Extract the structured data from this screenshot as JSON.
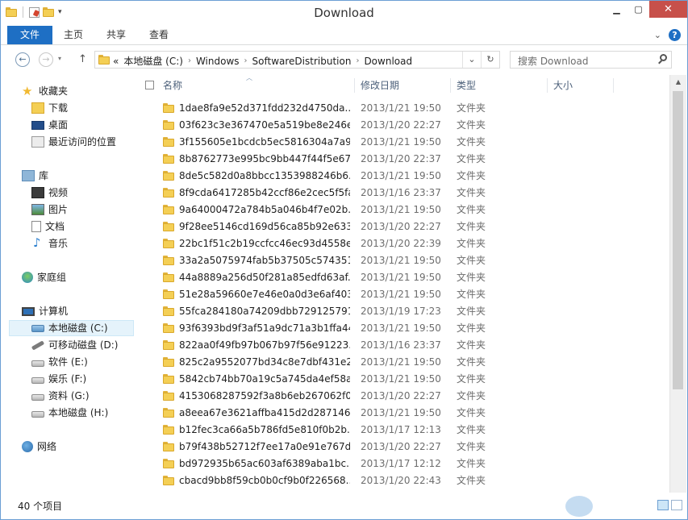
{
  "window": {
    "title": "Download"
  },
  "ribbon": {
    "tabs": [
      "文件",
      "主页",
      "共享",
      "查看"
    ],
    "help": "?"
  },
  "address": {
    "prefix": "«",
    "crumbs": [
      "本地磁盘 (C:)",
      "Windows",
      "SoftwareDistribution",
      "Download"
    ],
    "search_placeholder": "搜索 Download"
  },
  "nav": {
    "favorites": {
      "label": "收藏夹",
      "items": [
        "下载",
        "桌面",
        "最近访问的位置"
      ]
    },
    "libraries": {
      "label": "库",
      "items": [
        "视频",
        "图片",
        "文档",
        "音乐"
      ]
    },
    "homegroup": {
      "label": "家庭组"
    },
    "computer": {
      "label": "计算机",
      "items": [
        "本地磁盘 (C:)",
        "可移动磁盘 (D:)",
        "软件 (E:)",
        "娱乐 (F:)",
        "资料 (G:)",
        "本地磁盘 (H:)"
      ]
    },
    "network": {
      "label": "网络"
    }
  },
  "columns": {
    "name": "名称",
    "date": "修改日期",
    "type": "类型",
    "size": "大小"
  },
  "files": [
    {
      "name": "1dae8fa9e52d371fdd232d4750da...",
      "date": "2013/1/21 19:50",
      "type": "文件夹"
    },
    {
      "name": "03f623c3e367470e5a519be8e246e...",
      "date": "2013/1/20 22:27",
      "type": "文件夹"
    },
    {
      "name": "3f155605e1bcdcb5ec5816304a7a9...",
      "date": "2013/1/21 19:50",
      "type": "文件夹"
    },
    {
      "name": "8b8762773e995bc9bb447f44f5e67...",
      "date": "2013/1/20 22:37",
      "type": "文件夹"
    },
    {
      "name": "8de5c582d0a8bbcc1353988246b6...",
      "date": "2013/1/21 19:50",
      "type": "文件夹"
    },
    {
      "name": "8f9cda6417285b42ccf86e2cec5f5fa9",
      "date": "2013/1/16 23:37",
      "type": "文件夹"
    },
    {
      "name": "9a64000472a784b5a046b4f7e02b...",
      "date": "2013/1/21 19:50",
      "type": "文件夹"
    },
    {
      "name": "9f28ee5146cd169d56ca85b92e633...",
      "date": "2013/1/20 22:27",
      "type": "文件夹"
    },
    {
      "name": "22bc1f51c2b19ccfcc46ec93d4558e...",
      "date": "2013/1/20 22:39",
      "type": "文件夹"
    },
    {
      "name": "33a2a5075974fab5b37505c574351...",
      "date": "2013/1/21 19:50",
      "type": "文件夹"
    },
    {
      "name": "44a8889a256d50f281a85edfd63af...",
      "date": "2013/1/21 19:50",
      "type": "文件夹"
    },
    {
      "name": "51e28a59660e7e46e0a0d3e6af403...",
      "date": "2013/1/21 19:50",
      "type": "文件夹"
    },
    {
      "name": "55fca284180a74209dbb729125791...",
      "date": "2013/1/19 17:23",
      "type": "文件夹"
    },
    {
      "name": "93f6393bd9f3af51a9dc71a3b1ffa44c",
      "date": "2013/1/21 19:50",
      "type": "文件夹"
    },
    {
      "name": "822aa0f49fb97b067b97f56e91223...",
      "date": "2013/1/16 23:37",
      "type": "文件夹"
    },
    {
      "name": "825c2a9552077bd34c8e7dbf431e2...",
      "date": "2013/1/21 19:50",
      "type": "文件夹"
    },
    {
      "name": "5842cb74bb70a19c5a745da4ef58a...",
      "date": "2013/1/21 19:50",
      "type": "文件夹"
    },
    {
      "name": "4153068287592f3a8b6eb267062f0...",
      "date": "2013/1/20 22:27",
      "type": "文件夹"
    },
    {
      "name": "a8eea67e3621affba415d2d287146...",
      "date": "2013/1/21 19:50",
      "type": "文件夹"
    },
    {
      "name": "b12fec3ca66a5b786fd5e810f0b2b...",
      "date": "2013/1/17 12:13",
      "type": "文件夹"
    },
    {
      "name": "b79f438b52712f7ee17a0e91e767d...",
      "date": "2013/1/20 22:27",
      "type": "文件夹"
    },
    {
      "name": "bd972935b65ac603af6389aba1bc...",
      "date": "2013/1/17 12:12",
      "type": "文件夹"
    },
    {
      "name": "cbacd9bb8f59cb0b0cf9b0f226568...",
      "date": "2013/1/20 22:43",
      "type": "文件夹"
    }
  ],
  "status": {
    "count": "40 个项目"
  },
  "colors": {
    "accent": "#1e6fc4",
    "close": "#c7504a",
    "folder": "#f4cf55"
  }
}
